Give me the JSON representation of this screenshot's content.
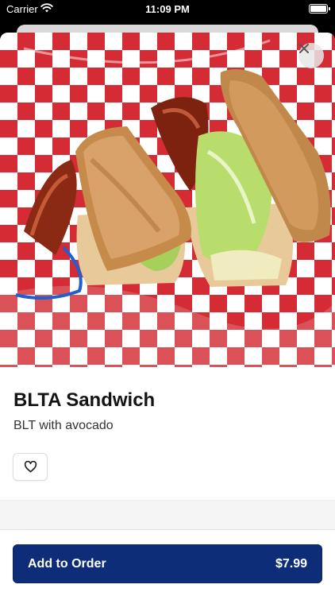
{
  "status_bar": {
    "carrier": "Carrier",
    "time": "11:09 PM"
  },
  "item": {
    "name": "BLTA Sandwich",
    "description": "BLT with avocado"
  },
  "order_button": {
    "label": "Add to Order",
    "price": "$7.99"
  },
  "icons": {
    "close": "close-icon",
    "favorite": "heart-outline-icon",
    "wifi": "wifi-icon",
    "battery": "battery-icon"
  },
  "colors": {
    "primary": "#0d2d79",
    "checker_red": "#d42b34"
  }
}
